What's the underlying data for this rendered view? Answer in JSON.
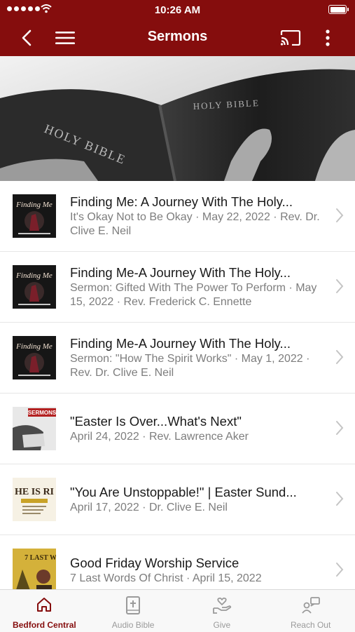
{
  "status": {
    "time": "10:26 AM"
  },
  "header": {
    "title": "Sermons"
  },
  "hero": {
    "book_left": "HOLY BIBLE",
    "book_right": "HOLY BIBLE"
  },
  "sermons": [
    {
      "title": "Finding Me: A Journey With The Holy...",
      "subtitle": "It's Okay Not to Be Okay · May 22, 2022 · Rev. Dr. Clive E. Neil",
      "thumb": "finding-me"
    },
    {
      "title": "Finding Me-A Journey With The Holy...",
      "subtitle": "Sermon: Gifted With The Power To Perform · May 15, 2022 · Rev. Frederick C. Ennette",
      "thumb": "finding-me"
    },
    {
      "title": "Finding Me-A Journey With The Holy...",
      "subtitle": "Sermon: \"How The Spirit Works\" · May 1, 2022 · Rev. Dr. Clive E. Neil",
      "thumb": "finding-me"
    },
    {
      "title": "\"Easter Is Over...What's Next\"",
      "subtitle": "April 24, 2022 · Rev. Lawrence Aker",
      "thumb": "sermons"
    },
    {
      "title": "\"You Are Unstoppable!\" | Easter Sund...",
      "subtitle": "April 17, 2022 · Dr. Clive E. Neil",
      "thumb": "he-is-risen"
    },
    {
      "title": "Good Friday Worship Service",
      "subtitle": "7 Last Words Of Christ · April 15, 2022",
      "thumb": "seven-last-words"
    }
  ],
  "tabs": [
    {
      "label": "Bedford Central",
      "icon": "home-icon",
      "active": true
    },
    {
      "label": "Audio Bible",
      "icon": "bible-icon",
      "active": false
    },
    {
      "label": "Give",
      "icon": "give-icon",
      "active": false
    },
    {
      "label": "Reach Out",
      "icon": "reach-out-icon",
      "active": false
    }
  ],
  "colors": {
    "brand": "#850d0d",
    "tab_inactive": "#9a9a9a",
    "subtitle": "#7d7d7d"
  }
}
